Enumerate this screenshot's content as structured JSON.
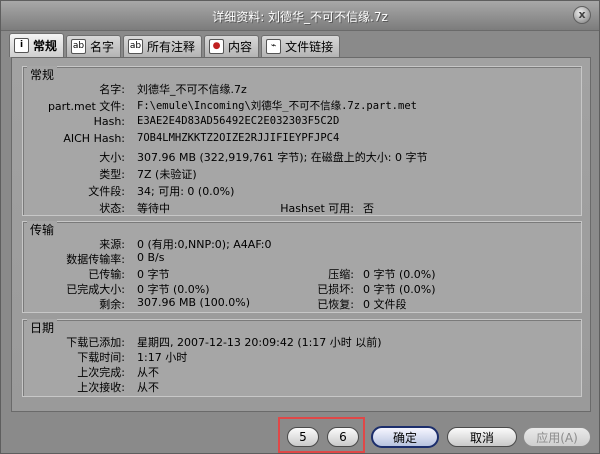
{
  "window": {
    "title": "详细资料: 刘德华_不可不信缘.7z",
    "close_glyph": "x"
  },
  "tabs": [
    {
      "label": "常规",
      "icon": "info-icon"
    },
    {
      "label": "名字",
      "icon": "name-icon"
    },
    {
      "label": "所有注释",
      "icon": "comments-icon"
    },
    {
      "label": "内容",
      "icon": "content-icon"
    },
    {
      "label": "文件链接",
      "icon": "link-icon"
    }
  ],
  "general": {
    "title": "常规",
    "name_label": "名字:",
    "name_value": "刘德华_不可不信缘.7z",
    "partmet_label": "part.met 文件:",
    "partmet_value": "F:\\emule\\Incoming\\刘德华_不可不信缘.7z.part.met",
    "hash_label": "Hash:",
    "hash_value": "E3AE2E4D83AD56492EC2E032303F5C2D",
    "aich_label": "AICH Hash:",
    "aich_value": "7OB4LMHZKKTZ2OIZE2RJJIFIEYPFJPC4",
    "size_label": "大小:",
    "size_value": "307.96 MB  (322,919,761 字节);  在磁盘上的大小: 0 字节",
    "type_label": "类型:",
    "type_value": "7Z  (未验证)",
    "parts_label": "文件段:",
    "parts_value": "34;  可用: 0 (0.0%)",
    "status_label": "状态:",
    "status_value": "等待中",
    "hashset_label": "Hashset 可用:",
    "hashset_value": "否"
  },
  "transfer": {
    "title": "传输",
    "sources_label": "来源:",
    "sources_value": "0 (有用:0,NNP:0); A4AF:0",
    "rate_label": "数据传输率:",
    "rate_value": "0 B/s",
    "transferred_label": "已传输:",
    "transferred_value": "0 字节",
    "compressed_label": "压缩:",
    "compressed_value": "0 字节 (0.0%)",
    "completed_label": "已完成大小:",
    "completed_value": "0 字节 (0.0%)",
    "corrupted_label": "已损坏:",
    "corrupted_value": "0 字节 (0.0%)",
    "remaining_label": "剩余:",
    "remaining_value": "307.96 MB (100.0%)",
    "recovered_label": "已恢复:",
    "recovered_value": "0 文件段"
  },
  "dates": {
    "title": "日期",
    "added_label": "下载已添加:",
    "added_value": "星期四, 2007-12-13 20:09:42   (1:17 小时 以前)",
    "time_label": "下载时间:",
    "time_value": "1:17 小时",
    "last_complete_label": "上次完成:",
    "last_complete_value": "从不",
    "last_received_label": "上次接收:",
    "last_received_value": "从不"
  },
  "buttons": {
    "prev": "5",
    "next": "6",
    "ok": "确定",
    "cancel": "取消",
    "apply": "应用(A)"
  },
  "colors": {
    "highlight": "#e04848",
    "primary_border": "#1c2e6c"
  }
}
